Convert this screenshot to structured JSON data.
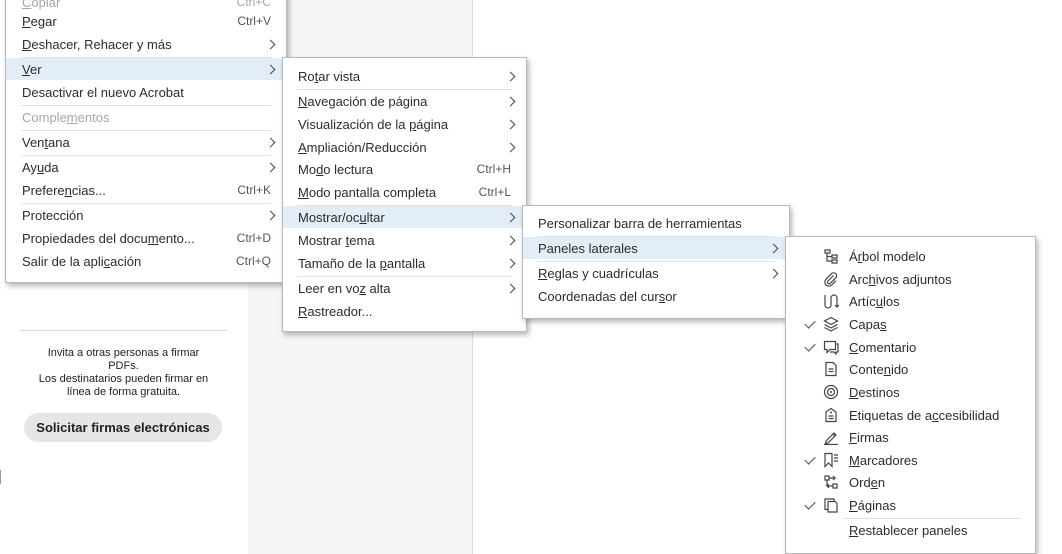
{
  "menus": {
    "main": {
      "items": {
        "copiar": {
          "pre": "",
          "u": "C",
          "post": "opiar",
          "shortcut": "Ctrl+C"
        },
        "pegar": {
          "pre": "",
          "u": "P",
          "post": "egar",
          "shortcut": "Ctrl+V"
        },
        "deshacer": {
          "pre": "",
          "u": "D",
          "post": "eshacer, Rehacer y más"
        },
        "ver": {
          "pre": "",
          "u": "V",
          "post": "er"
        },
        "desactivar": {
          "label": "Desactivar el nuevo Acrobat"
        },
        "complementos": {
          "pre": "Comple",
          "u": "m",
          "post": "entos"
        },
        "ventana": {
          "pre": "Ven",
          "u": "t",
          "post": "ana"
        },
        "ayuda": {
          "pre": "Ay",
          "u": "u",
          "post": "da"
        },
        "preferencias": {
          "pre": "Prefere",
          "u": "n",
          "post": "cias...",
          "shortcut": "Ctrl+K"
        },
        "proteccion": {
          "label": "Protección"
        },
        "propiedades": {
          "pre": "Propiedades del docu",
          "u": "m",
          "post": "ento...",
          "shortcut": "Ctrl+D"
        },
        "salir": {
          "pre": "Salir de la apli",
          "u": "c",
          "post": "ación",
          "shortcut": "Ctrl+Q"
        }
      }
    },
    "ver": {
      "items": {
        "rotar": {
          "pre": "Ro",
          "u": "t",
          "post": "ar vista"
        },
        "navegacion": {
          "pre": "",
          "u": "N",
          "post": "avegación de página"
        },
        "visualizacion": {
          "pre": "Visualización de la ",
          "u": "p",
          "post": "ágina"
        },
        "ampliacion": {
          "pre": "",
          "u": "A",
          "post": "mpliación/Reducción"
        },
        "lectura": {
          "pre": "Mo",
          "u": "d",
          "post": "o lectura",
          "shortcut": "Ctrl+H"
        },
        "pantalla": {
          "pre": "",
          "u": "M",
          "post": "odo pantalla completa",
          "shortcut": "Ctrl+L"
        },
        "mostrar": {
          "pre": "Mostrar/oc",
          "u": "u",
          "post": "ltar"
        },
        "tema": {
          "pre": "Mostrar ",
          "u": "t",
          "post": "ema"
        },
        "tamano": {
          "pre": "Tamaño de la ",
          "u": "p",
          "post": "antalla"
        },
        "leer": {
          "pre": "Leer en vo",
          "u": "z",
          "post": " alta"
        },
        "rastreador": {
          "pre": "",
          "u": "R",
          "post": "astreador..."
        }
      }
    },
    "mostrar": {
      "items": {
        "personalizar": {
          "label": "Personalizar barra de herramientas"
        },
        "paneles": {
          "label": "Paneles laterales"
        },
        "reglas": {
          "pre": "",
          "u": "R",
          "post": "eglas y cuadrículas"
        },
        "coordenadas": {
          "pre": "Coordenadas del cur",
          "u": "s",
          "post": "or"
        }
      }
    },
    "paneles": {
      "items": {
        "arbol": {
          "pre": "Á",
          "u": "r",
          "post": "bol modelo",
          "icon": "tree-icon",
          "checked": false
        },
        "archivos": {
          "pre": "Arc",
          "u": "h",
          "post": "ivos adjuntos",
          "icon": "paperclip-icon",
          "checked": false
        },
        "articulos": {
          "pre": "Artíc",
          "u": "u",
          "post": "los",
          "icon": "articles-icon",
          "checked": false
        },
        "capas": {
          "pre": "Capa",
          "u": "s",
          "post": "",
          "icon": "layers-icon",
          "checked": true
        },
        "comentario": {
          "pre": "",
          "u": "C",
          "post": "omentario",
          "icon": "comment-icon",
          "checked": true
        },
        "contenido": {
          "pre": "Conte",
          "u": "n",
          "post": "ido",
          "icon": "content-icon",
          "checked": false
        },
        "destinos": {
          "pre": "",
          "u": "D",
          "post": "estinos",
          "icon": "destinations-icon",
          "checked": false
        },
        "etiquetas": {
          "pre": "Etiquetas de a",
          "u": "c",
          "post": "cesibilidad",
          "icon": "tags-icon",
          "checked": false
        },
        "firmas": {
          "pre": "",
          "u": "F",
          "post": "irmas",
          "icon": "signature-icon",
          "checked": false
        },
        "marcadores": {
          "pre": "",
          "u": "M",
          "post": "arcadores",
          "icon": "bookmark-icon",
          "checked": true
        },
        "orden": {
          "pre": "Ord",
          "u": "e",
          "post": "n",
          "icon": "order-icon",
          "checked": false
        },
        "paginas": {
          "pre": "",
          "u": "P",
          "post": "áginas",
          "icon": "pages-icon",
          "checked": true
        },
        "restablecer": {
          "pre": "",
          "u": "R",
          "post": "establecer paneles"
        }
      }
    }
  },
  "side_panel": {
    "invite_line1": "Invita a otras personas a firmar",
    "invite_line2": "PDFs.",
    "invite_line3": "Los destinatarios pueden firmar en",
    "invite_line4": "línea de forma gratuita.",
    "button_label": "Solicitar firmas electrónicas"
  }
}
